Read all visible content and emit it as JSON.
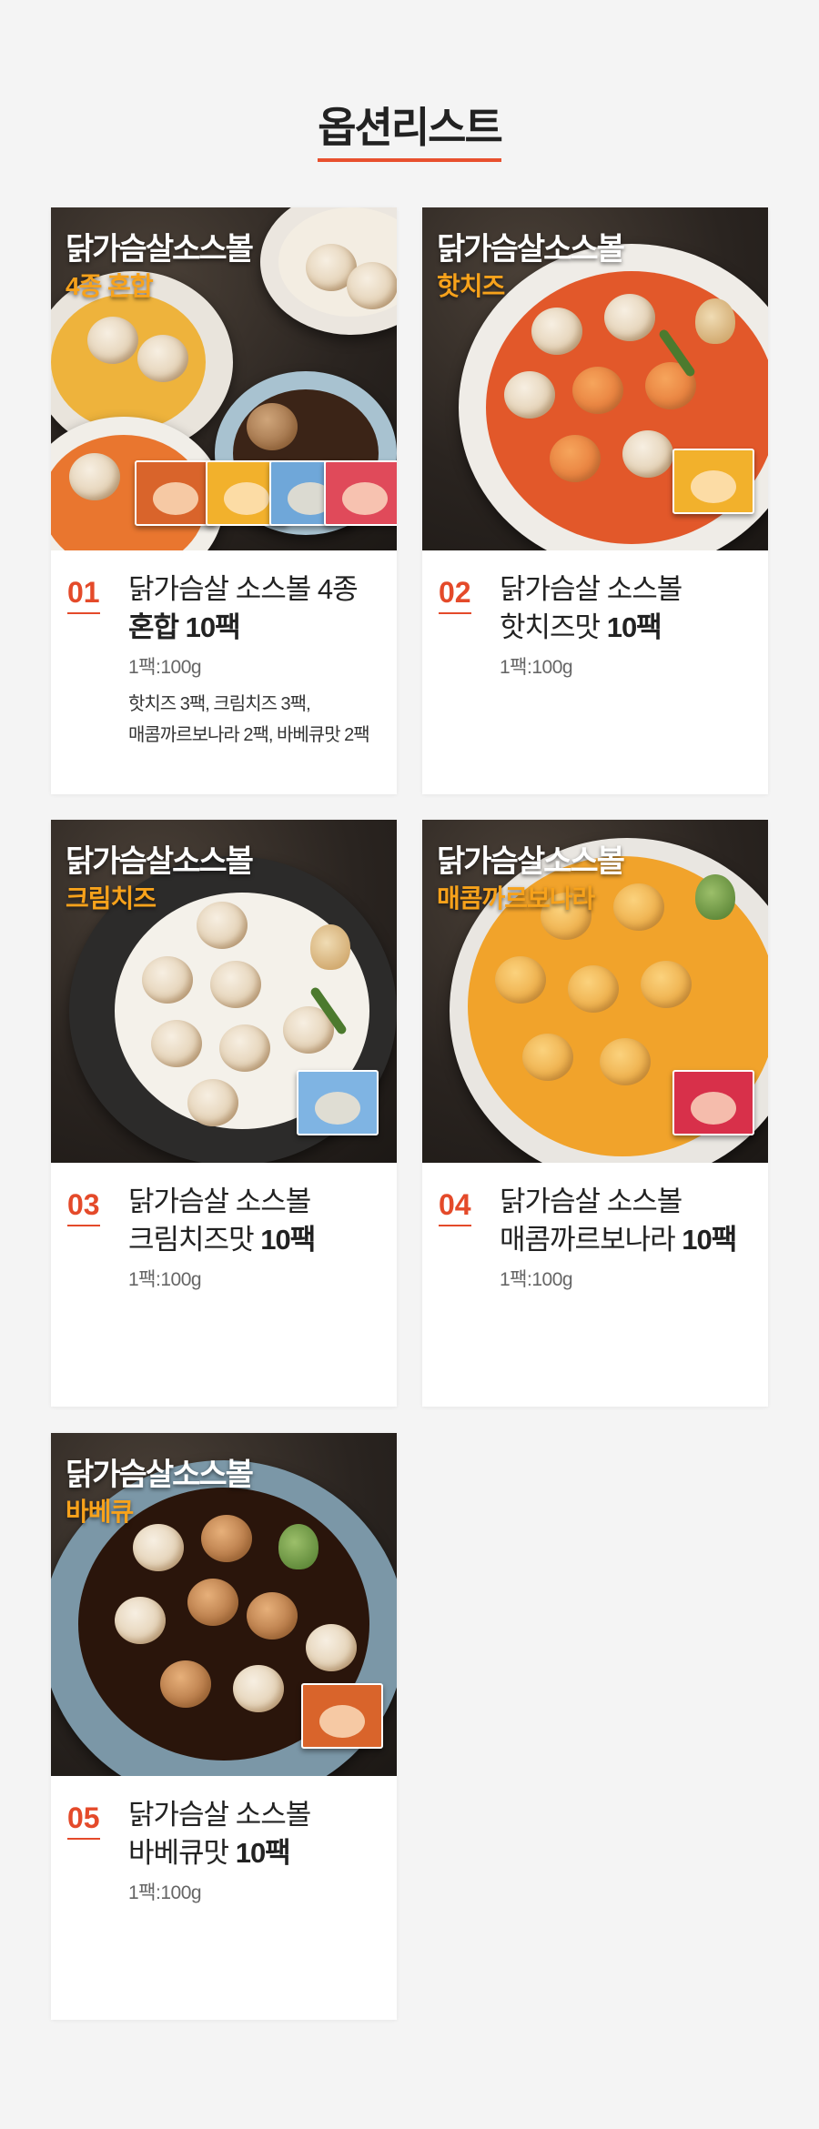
{
  "page": {
    "title": "옵션리스트",
    "accent": "#e8502e"
  },
  "options": [
    {
      "number": "01",
      "image_title": "닭가슴살소스볼",
      "image_sub": "4종 혼합",
      "name_line1": "닭가슴살 소스볼 4종",
      "name_line2_bold": "혼합 10팩",
      "name_line2_pre": "",
      "spec": "1팩:100g",
      "note_line1": "핫치즈 3팩, 크림치즈 3팩,",
      "note_line2": "매콤까르보나라 2팩, 바베큐맛 2팩"
    },
    {
      "number": "02",
      "image_title": "닭가슴살소스볼",
      "image_sub": "핫치즈",
      "name_line1": "닭가슴살 소스볼",
      "name_line2_pre": "핫치즈맛 ",
      "name_line2_bold": "10팩",
      "spec": "1팩:100g"
    },
    {
      "number": "03",
      "image_title": "닭가슴살소스볼",
      "image_sub": "크림치즈",
      "name_line1": "닭가슴살 소스볼",
      "name_line2_pre": "크림치즈맛 ",
      "name_line2_bold": "10팩",
      "spec": "1팩:100g"
    },
    {
      "number": "04",
      "image_title": "닭가슴살소스볼",
      "image_sub": "매콤까르보나라",
      "name_line1": "닭가슴살 소스볼",
      "name_line2_pre": "매콤까르보나라 ",
      "name_line2_bold": "10팩",
      "spec": "1팩:100g"
    },
    {
      "number": "05",
      "image_title": "닭가슴살소스볼",
      "image_sub": "바베큐",
      "name_line1": "닭가슴살 소스볼",
      "name_line2_pre": "바베큐맛 ",
      "name_line2_bold": "10팩",
      "spec": "1팩:100g"
    }
  ]
}
